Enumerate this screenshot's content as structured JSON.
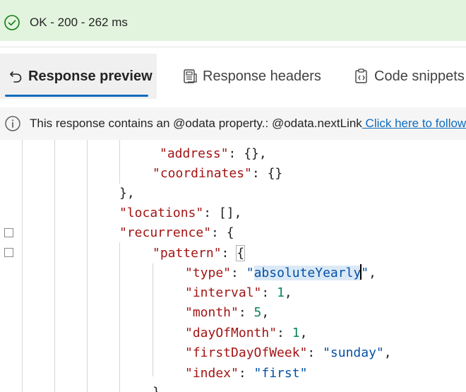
{
  "status": {
    "text": "OK - 200 - 262 ms",
    "color": "#e2f4de"
  },
  "tabs": [
    {
      "label": "Response preview",
      "icon": "undo-arrow-icon",
      "active": true
    },
    {
      "label": "Response headers",
      "icon": "document-header-icon",
      "active": false
    },
    {
      "label": "Code snippets",
      "icon": "code-clipboard-icon",
      "active": false
    }
  ],
  "info": {
    "message": "This response contains an @odata property.: @odata.nextLink",
    "link": " Click here to follow the link"
  },
  "code": {
    "l0_key": "\"address\"",
    "l0_rest": ": {},",
    "l1_key": "\"coordinates\"",
    "l1_rest": ": {}",
    "l2": "},",
    "l3_key": "\"locations\"",
    "l3_rest": ": [],",
    "l4_key": "\"recurrence\"",
    "l4_rest": ": {",
    "l5_key": "\"pattern\"",
    "l5_colon": ": ",
    "l5_brace": "{",
    "l6_key": "\"type\"",
    "l6_colon": ": ",
    "l6_q1": "\"",
    "l6_sel": "absoluteYearly",
    "l6_q2": "\"",
    "l6_end": ",",
    "l7_key": "\"interval\"",
    "l7_colon": ": ",
    "l7_val": "1",
    "l7_end": ",",
    "l8_key": "\"month\"",
    "l8_colon": ": ",
    "l8_val": "5",
    "l8_end": ",",
    "l9_key": "\"dayOfMonth\"",
    "l9_colon": ": ",
    "l9_val": "1",
    "l9_end": ",",
    "l10_key": "\"firstDayOfWeek\"",
    "l10_colon": ": ",
    "l10_val": "\"sunday\"",
    "l10_end": ",",
    "l11_key": "\"index\"",
    "l11_colon": ": ",
    "l11_val": "\"first\"",
    "l12": "},"
  }
}
